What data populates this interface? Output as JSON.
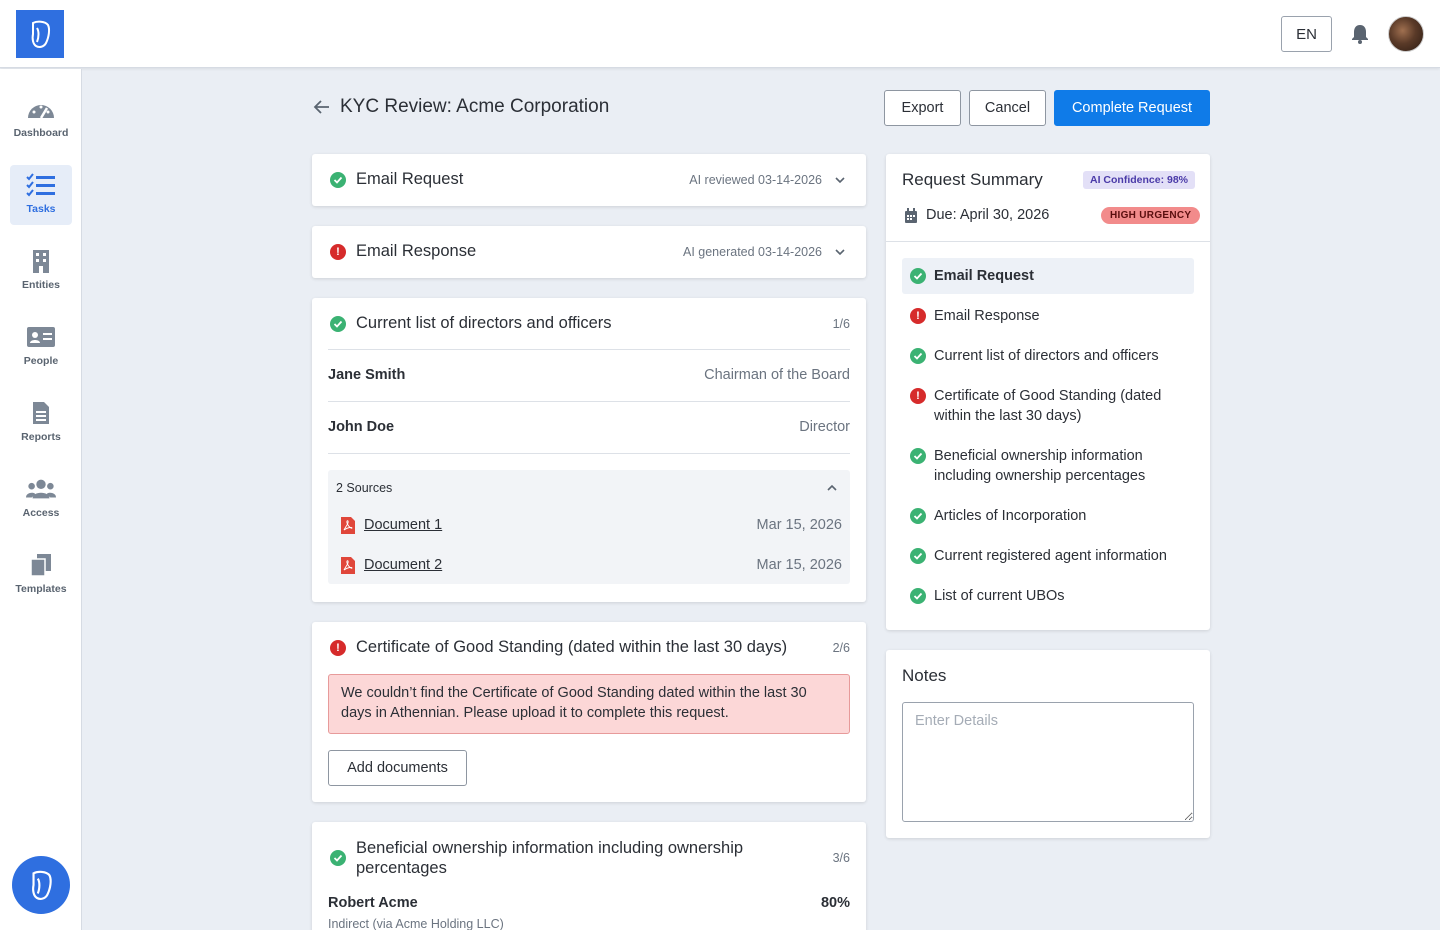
{
  "topbar": {
    "language": "EN"
  },
  "sidebar": {
    "items": [
      {
        "label": "Dashboard"
      },
      {
        "label": "Tasks"
      },
      {
        "label": "Entities"
      },
      {
        "label": "People"
      },
      {
        "label": "Reports"
      },
      {
        "label": "Access"
      },
      {
        "label": "Templates"
      }
    ],
    "active": "Tasks"
  },
  "header": {
    "title": "KYC Review: Acme Corporation",
    "export_label": "Export",
    "cancel_label": "Cancel",
    "complete_label": "Complete Request"
  },
  "cards": {
    "email_request": {
      "title": "Email Request",
      "meta": "AI reviewed 03-14-2026",
      "status": "ok"
    },
    "email_response": {
      "title": "Email Response",
      "meta": "AI generated 03-14-2026",
      "status": "error"
    },
    "directors": {
      "title": "Current list of directors and officers",
      "count": "1/6",
      "status": "ok",
      "people": [
        {
          "name": "Jane Smith",
          "role": "Chairman of the Board"
        },
        {
          "name": "John Doe",
          "role": "Director"
        }
      ],
      "sources_label": "2 Sources",
      "documents": [
        {
          "name": "Document 1",
          "date": "Mar 15, 2026"
        },
        {
          "name": "Document 2",
          "date": "Mar 15, 2026"
        }
      ]
    },
    "good_standing": {
      "title": "Certificate of Good Standing (dated within the last 30 days)",
      "count": "2/6",
      "status": "error",
      "error_message": "We couldn’t find the Certificate of Good Standing dated within the last 30 days in Athennian. Please upload it to complete this request.",
      "add_documents_label": "Add documents"
    },
    "beneficial": {
      "title": "Beneficial ownership information including ownership percentages",
      "count": "3/6",
      "status": "ok",
      "owner_name": "Robert Acme",
      "owner_pct": "80%",
      "owner_detail": "Indirect (via Acme Holding LLC)"
    }
  },
  "summary": {
    "title": "Request Summary",
    "confidence": "AI Confidence: 98%",
    "due": "Due: April 30, 2026",
    "urgency": "HIGH URGENCY",
    "items": [
      {
        "label": "Email Request",
        "status": "ok"
      },
      {
        "label": "Email Response",
        "status": "error"
      },
      {
        "label": "Current list of directors and officers",
        "status": "ok"
      },
      {
        "label": "Certificate of Good Standing (dated within the last 30 days)",
        "status": "error"
      },
      {
        "label": "Beneficial ownership information including ownership percentages",
        "status": "ok"
      },
      {
        "label": "Articles of Incorporation",
        "status": "ok"
      },
      {
        "label": "Current registered agent information",
        "status": "ok"
      },
      {
        "label": "List of current UBOs",
        "status": "ok"
      }
    ]
  },
  "notes": {
    "title": "Notes",
    "placeholder": "Enter Details"
  },
  "colors": {
    "accent": "#0f7be8",
    "brand": "#2f6fe0",
    "ok": "#3bb273",
    "error": "#d62b2b"
  }
}
